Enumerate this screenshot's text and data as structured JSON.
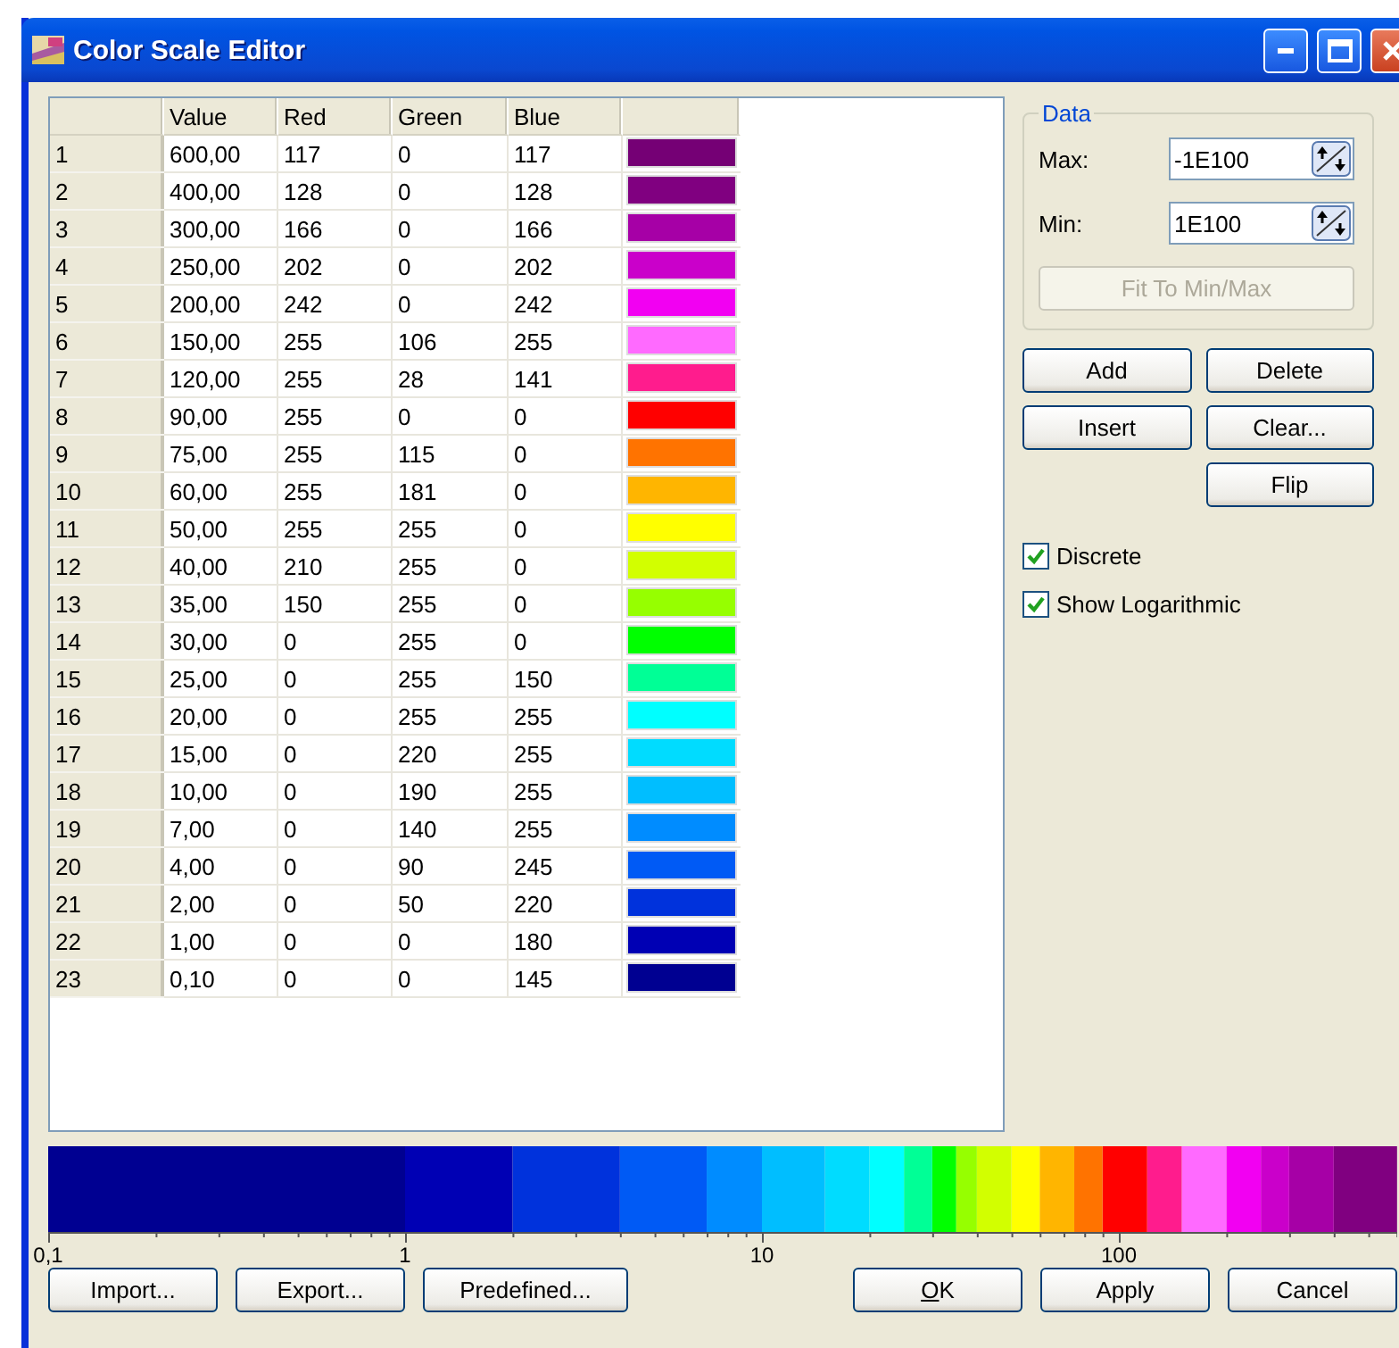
{
  "window": {
    "title": "Color Scale Editor"
  },
  "table": {
    "columns": [
      "Value",
      "Red",
      "Green",
      "Blue"
    ],
    "rows": [
      {
        "index": "1",
        "value": "600,00",
        "red": "117",
        "green": "0",
        "blue": "117",
        "color": "#750075"
      },
      {
        "index": "2",
        "value": "400,00",
        "red": "128",
        "green": "0",
        "blue": "128",
        "color": "#800080"
      },
      {
        "index": "3",
        "value": "300,00",
        "red": "166",
        "green": "0",
        "blue": "166",
        "color": "#a600a6"
      },
      {
        "index": "4",
        "value": "250,00",
        "red": "202",
        "green": "0",
        "blue": "202",
        "color": "#ca00ca"
      },
      {
        "index": "5",
        "value": "200,00",
        "red": "242",
        "green": "0",
        "blue": "242",
        "color": "#f200f2"
      },
      {
        "index": "6",
        "value": "150,00",
        "red": "255",
        "green": "106",
        "blue": "255",
        "color": "#ff6aff"
      },
      {
        "index": "7",
        "value": "120,00",
        "red": "255",
        "green": "28",
        "blue": "141",
        "color": "#ff1c8d"
      },
      {
        "index": "8",
        "value": "90,00",
        "red": "255",
        "green": "0",
        "blue": "0",
        "color": "#ff0000"
      },
      {
        "index": "9",
        "value": "75,00",
        "red": "255",
        "green": "115",
        "blue": "0",
        "color": "#ff7300"
      },
      {
        "index": "10",
        "value": "60,00",
        "red": "255",
        "green": "181",
        "blue": "0",
        "color": "#ffb500"
      },
      {
        "index": "11",
        "value": "50,00",
        "red": "255",
        "green": "255",
        "blue": "0",
        "color": "#ffff00"
      },
      {
        "index": "12",
        "value": "40,00",
        "red": "210",
        "green": "255",
        "blue": "0",
        "color": "#d2ff00"
      },
      {
        "index": "13",
        "value": "35,00",
        "red": "150",
        "green": "255",
        "blue": "0",
        "color": "#96ff00"
      },
      {
        "index": "14",
        "value": "30,00",
        "red": "0",
        "green": "255",
        "blue": "0",
        "color": "#00ff00"
      },
      {
        "index": "15",
        "value": "25,00",
        "red": "0",
        "green": "255",
        "blue": "150",
        "color": "#00ff96"
      },
      {
        "index": "16",
        "value": "20,00",
        "red": "0",
        "green": "255",
        "blue": "255",
        "color": "#00ffff"
      },
      {
        "index": "17",
        "value": "15,00",
        "red": "0",
        "green": "220",
        "blue": "255",
        "color": "#00dcff"
      },
      {
        "index": "18",
        "value": "10,00",
        "red": "0",
        "green": "190",
        "blue": "255",
        "color": "#00beff"
      },
      {
        "index": "19",
        "value": "7,00",
        "red": "0",
        "green": "140",
        "blue": "255",
        "color": "#008cff"
      },
      {
        "index": "20",
        "value": "4,00",
        "red": "0",
        "green": "90",
        "blue": "245",
        "color": "#005af5"
      },
      {
        "index": "21",
        "value": "2,00",
        "red": "0",
        "green": "50",
        "blue": "220",
        "color": "#0032dc"
      },
      {
        "index": "22",
        "value": "1,00",
        "red": "0",
        "green": "0",
        "blue": "180",
        "color": "#0000b4"
      },
      {
        "index": "23",
        "value": "0,10",
        "red": "0",
        "green": "0",
        "blue": "145",
        "color": "#000091"
      }
    ]
  },
  "data_group": {
    "title": "Data",
    "max": {
      "label": "Max:",
      "value": "-1E100"
    },
    "min": {
      "label": "Min:",
      "value": "1E100"
    },
    "fit_button": {
      "label": "Fit To Min/Max",
      "disabled": true
    }
  },
  "buttons": [
    {
      "label": "Add"
    },
    {
      "label": "Delete"
    },
    {
      "label": "Insert"
    },
    {
      "label": "Clear..."
    },
    {
      "label": "Flip"
    }
  ],
  "options": [
    {
      "label": "Discrete",
      "checked": true
    },
    {
      "label": "Show Logarithmic",
      "checked": true
    }
  ],
  "scale": {
    "ticks": [
      "0,1",
      "1",
      "10",
      "100"
    ]
  },
  "footer": {
    "left": [
      {
        "label": "Import..."
      },
      {
        "label": "Export..."
      },
      {
        "label": "Predefined..."
      }
    ],
    "right": [
      {
        "label": "OK",
        "underline_first": true
      },
      {
        "label": "Apply",
        "underline_first": false
      },
      {
        "label": "Cancel",
        "underline_first": false
      }
    ]
  }
}
